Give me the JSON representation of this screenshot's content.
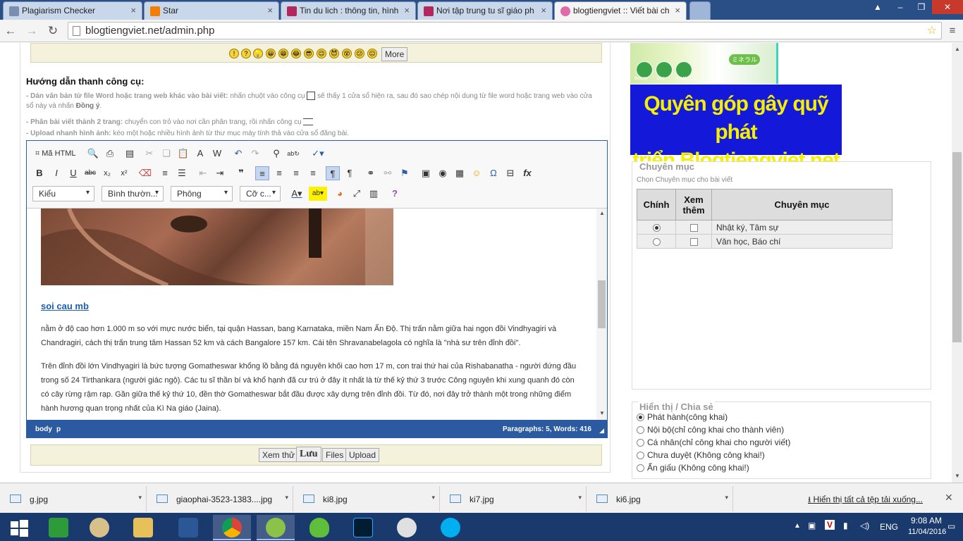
{
  "browser": {
    "tabs": [
      {
        "title": "Plagiarism Checker",
        "color": "#7a8fb0",
        "active": false
      },
      {
        "title": "Star",
        "color": "#f57d00",
        "active": false
      },
      {
        "title": "Tin du lich : thông tin, hình",
        "color": "#b5265d",
        "active": false
      },
      {
        "title": "Nơi tập trung tu sĩ giáo ph",
        "color": "#b5265d",
        "active": false
      },
      {
        "title": "blogtiengviet :: Viết bài ch",
        "color": "#e06aa8",
        "active": true
      }
    ],
    "url": "blogtiengviet.net/admin.php"
  },
  "smileybar": {
    "smileys": [
      "!",
      "?",
      "💡",
      "😀",
      "😁",
      "😂",
      "😎",
      "😉",
      "😈",
      "😵",
      "😕",
      "😐"
    ],
    "more_label": "More"
  },
  "guide": {
    "title": "Hướng dẫn thanh công cụ:",
    "line1_bold": "- Dán văn bản từ file Word hoặc trang web khác vào bài viết:",
    "line1_text": " nhấn chuột vào công cụ",
    "line1_text2": " sẽ thấy 1 cửa sổ hiện ra, sau đó sao chép nội dung từ file word hoặc trang web vào cửa sổ này và nhấn ",
    "line1_end": "Đồng ý",
    "line2_bold": "- Phân bài viết thành 2 trang:",
    "line2_text": " chuyển con trỏ vào nơi cần phân trang, rồi nhấn công cụ",
    "line3_bold": "- Upload nhanh hình ảnh:",
    "line3_text": " kéo một hoặc nhiều hình ảnh từ thư mục máy tính thả vào cửa sổ đăng bài."
  },
  "editor": {
    "source_label": "Mã HTML",
    "combo_style": "Kiểu",
    "combo_format": "Bình thườn...",
    "combo_font": "Phông",
    "combo_size": "Cỡ c...",
    "link_text": "soi cau mb",
    "para1": "nằm ở độ cao hơn 1.000 m so với mực nước biển, tại quận Hassan, bang Karnataka, miền Nam Ấn Độ. Thị trấn nằm giữa hai ngọn đồi Vindhyagiri và Chandragiri, cách thị trấn trung tâm Hassan 52 km và cách Bangalore 157 km. Cái tên Shravanabelagola có nghĩa là \"nhà sư trên đỉnh đồi\".",
    "para2": "Trên đỉnh đồi lớn Vindhyagiri là bức tượng Gomatheswar khổng lồ bằng đá nguyên khối cao hơn 17 m, con trai thứ hai của Rishabanatha - người đứng đầu trong số 24 Tirthankara (người giác ngộ). Các tu sĩ thần bí và khổ hạnh đã cư trú ở đây ít nhất là từ thế kỷ thứ 3 trước Công nguyên khi xung quanh đó còn có cây rừng rậm rạp. Gần giữa thế kỷ thứ 10, đền thờ Gomatheswar bắt đầu được xây dựng trên đỉnh đồi. Từ đó, nơi đây trở thành một trong những điểm hành hương quan trọng nhất của Kì Na giáo (Jaina).",
    "status_path1": "body",
    "status_path2": "p",
    "status_counts": "Paragraphs: 5, Words: 416"
  },
  "actions": {
    "preview": "Xem thử",
    "save": "Lưu",
    "files": "Files",
    "upload": "Upload"
  },
  "banner": {
    "line1": "Quyên góp gây quỹ phát",
    "line2": "triển Blogtiengviet.net",
    "bg": "#1418d8",
    "fg": "#f5f000",
    "icons": [
      "Beauty",
      "Diet",
      "Health"
    ],
    "top_label": "ミネラル"
  },
  "category": {
    "title": "Chuyên mục",
    "subtitle": "Chọn Chuyên mục cho bài viết",
    "headers": [
      "Chính",
      "Xem thêm",
      "Chuyên mục"
    ],
    "rows": [
      {
        "name": "Nhật ký, Tâm sự",
        "main": true,
        "more": false
      },
      {
        "name": "Văn học, Báo chí",
        "main": false,
        "more": false
      }
    ]
  },
  "visibility": {
    "title": "Hiển thị / Chia sẻ",
    "options": [
      {
        "label": "Phát hành(công khai)",
        "selected": true
      },
      {
        "label": "Nội bộ(chỉ công khai cho thành viên)",
        "selected": false
      },
      {
        "label": "Cá nhân(chỉ công khai cho người viết)",
        "selected": false
      },
      {
        "label": "Chưa duyệt (Không công khai!)",
        "selected": false
      },
      {
        "label": "Ẩn giấu (Không công khai!)",
        "selected": false
      }
    ]
  },
  "downloads": {
    "items": [
      "g.jpg",
      "giaophai-3523-1383....jpg",
      "ki8.jpg",
      "ki7.jpg",
      "ki6.jpg"
    ],
    "show_all": "Hiển thị tất cả tệp tải xuống..."
  },
  "taskbar": {
    "lang": "ENG",
    "time": "9:08 AM",
    "date": "11/04/2016"
  }
}
